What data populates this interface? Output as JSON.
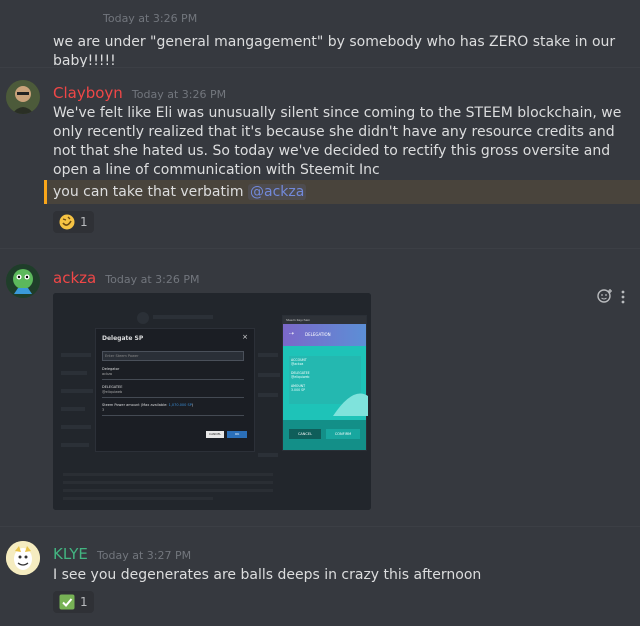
{
  "messages": [
    {
      "timestamp": "Today at 3:26 PM",
      "text": "we are under \"general mangagement\" by somebody who has ZERO stake in our baby!!!!!"
    },
    {
      "author": "Clayboyn",
      "author_color": "#f04747",
      "timestamp": "Today at 3:26 PM",
      "text": "We've felt like Eli was unusually silent since coming to the STEEM blockchain, we only recently realized that it's because she didn't have any resource credits and not that she hated us.  So today we've decided to rectify this gross oversite and open a line of communication with Steemit Inc",
      "followup": "you can take that verbatim",
      "mention": "@ackza",
      "reaction_icon": "rofl-emoji-icon",
      "reaction_count": "1"
    },
    {
      "author": "ackza",
      "author_color": "#f04747",
      "timestamp": "Today at 3:26 PM",
      "embed": {
        "dialog_title": "Delegate SP",
        "dialog_close": "×",
        "placeholder": "Enter Steem Power",
        "delegator_label": "Delegator",
        "delegator_value": "ackza",
        "delegatee_label": "DELEGATEE",
        "delegatee_value": "@eliquiweb",
        "amount_label": "Steem Power amount (Max available:",
        "amount_max": "1,070.000 SP",
        "amount_close": ")",
        "amount_value": "3",
        "cancel": "CANCEL",
        "ok": "OK",
        "wallet_title": "Steem Keychain",
        "wallet_header": "DELEGATION",
        "account_label": "ACCOUNT",
        "account_value": "@ackza",
        "amount_label2": "AMOUNT",
        "amount_value2": "3.000 SP",
        "wallet_cancel": "CANCEL",
        "wallet_confirm": "CONFIRM"
      }
    },
    {
      "author": "KLYE",
      "author_color": "#43b581",
      "timestamp": "Today at 3:27 PM",
      "text": "I see you degenerates are balls deeps in crazy this afternoon",
      "reaction_icon": "check-mark-icon",
      "reaction_count": "1"
    }
  ],
  "colors": {
    "background": "#36393f",
    "highlight": "#faa61a",
    "mention": "#7289da"
  }
}
